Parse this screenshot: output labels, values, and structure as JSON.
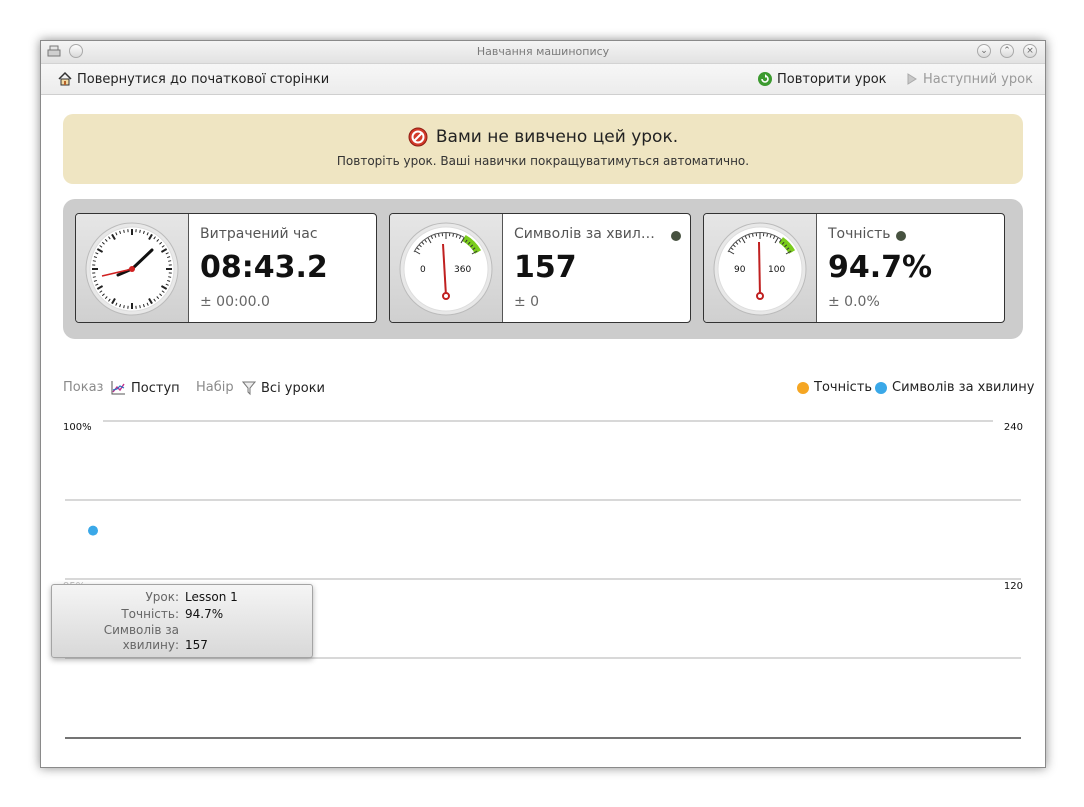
{
  "window": {
    "title": "Навчання машинопису"
  },
  "toolbar": {
    "home_label": "Повернутися до початкової сторінки",
    "repeat_label": "Повторити урок",
    "next_label": "Наступний урок"
  },
  "banner": {
    "title": "Вами не вивчено цей урок.",
    "subtitle": "Повторіть урок. Ваші навички покращуватимуться автоматично."
  },
  "stats": {
    "time": {
      "label": "Витрачений час",
      "value": "08:43.2",
      "deviation": "± 00:00.0"
    },
    "speed": {
      "label": "Символів за хвил…",
      "value": "157",
      "deviation": "± 0",
      "gauge_min": "0",
      "gauge_max": "360"
    },
    "accuracy": {
      "label": "Точність",
      "value": "94.7%",
      "deviation": "± 0.0%",
      "gauge_min": "90",
      "gauge_max": "100"
    },
    "indicator_color": "#475240"
  },
  "filters": {
    "show_label": "Показ",
    "show_value": "Поступ",
    "set_label": "Набір",
    "set_value": "Всі уроки"
  },
  "legend": {
    "accuracy": "Точність",
    "speed": "Символів за хвилину",
    "accuracy_color": "#f5a623",
    "speed_color": "#3aa8e8"
  },
  "chart_data": {
    "type": "scatter",
    "left_axis_labels": [
      "100%",
      "95%"
    ],
    "right_axis_labels": [
      "240",
      "120"
    ],
    "series": [
      {
        "name": "Точність",
        "values": [
          94.7
        ]
      },
      {
        "name": "Символів за хвилину",
        "values": [
          157
        ]
      }
    ],
    "categories": [
      "Lesson 1"
    ],
    "grid": true
  },
  "tooltip": {
    "lesson_key": "Урок:",
    "lesson_val": "Lesson 1",
    "accuracy_key": "Точність:",
    "accuracy_val": "94.7%",
    "speed_key_1": "Символів за",
    "speed_key_2": "хвилину:",
    "speed_val": "157"
  }
}
